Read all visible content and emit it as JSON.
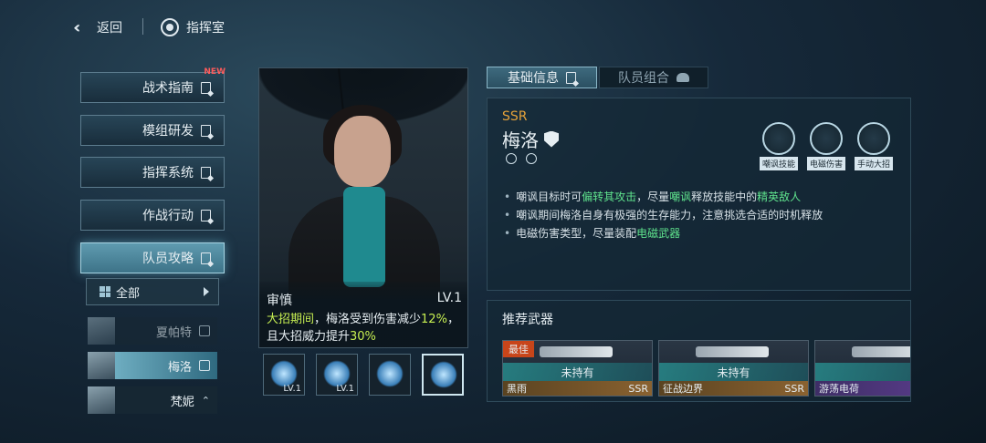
{
  "topbar": {
    "back_label": "返回",
    "breadcrumb": "指挥室"
  },
  "menu": [
    {
      "label": "战术指南",
      "badge": "NEW"
    },
    {
      "label": "模组研发"
    },
    {
      "label": "指挥系统"
    },
    {
      "label": "作战行动"
    },
    {
      "label": "队员攻略"
    }
  ],
  "filter": {
    "label": "全部"
  },
  "characters": [
    {
      "name": "夏帕特"
    },
    {
      "name": "梅洛"
    },
    {
      "name": "梵妮"
    }
  ],
  "trait": {
    "name": "审慎",
    "level": "LV.1",
    "text_hl1": "大招期间",
    "text_w1": "，梅洛受到伤害减少",
    "text_hl2": "12%",
    "text_w2": "，且大招威力提升",
    "text_hl3": "30%"
  },
  "skills": [
    {
      "level": "LV.1"
    },
    {
      "level": "LV.1"
    },
    {
      "level": ""
    },
    {
      "level": ""
    }
  ],
  "tabs": {
    "basic": "基础信息",
    "team": "队员组合"
  },
  "info": {
    "rarity": "SSR",
    "name": "梅洛",
    "tags": [
      "嘲讽技能",
      "电磁伤害",
      "手动大招"
    ],
    "notes": [
      {
        "a": "嘲讽目标时可",
        "b": "偏转其攻击",
        "c": "，尽量",
        "d": "嘲讽",
        "e": "释放技能中的",
        "f": "精英敌人",
        "g": ""
      },
      {
        "a": "嘲讽期间梅洛自身有极强的生存能力，注意挑选合适的时机释放",
        "b": "",
        "c": "",
        "d": "",
        "e": "",
        "f": "",
        "g": ""
      },
      {
        "a": "电磁伤害类型，尽量装配",
        "b": "电磁武器",
        "c": "",
        "d": "",
        "e": "",
        "f": "",
        "g": ""
      }
    ]
  },
  "weapons": {
    "title": "推荐武器",
    "best_label": "最佳",
    "items": [
      {
        "status": "未持有",
        "name": "黑雨",
        "rarity": "SSR"
      },
      {
        "status": "未持有",
        "name": "征战边界",
        "rarity": "SSR"
      },
      {
        "status": "未持",
        "name": "游荡电荷",
        "rarity": ""
      }
    ]
  }
}
